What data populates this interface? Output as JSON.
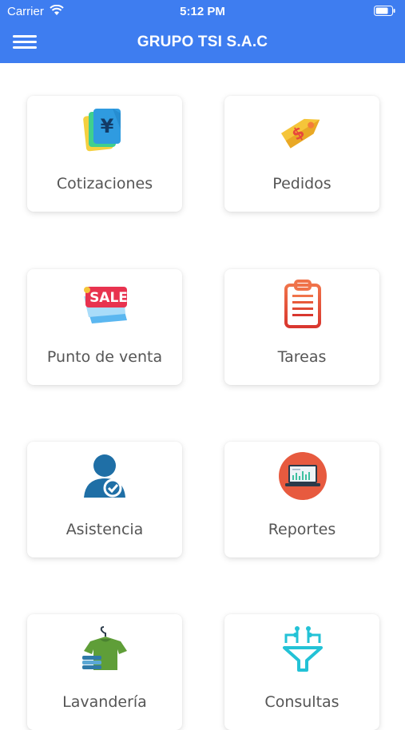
{
  "status_bar": {
    "carrier": "Carrier",
    "time": "5:12 PM"
  },
  "header": {
    "title": "GRUPO TSI S.A.C"
  },
  "modules": [
    {
      "label": "Cotizaciones",
      "icon": "banknote-icon"
    },
    {
      "label": "Pedidos",
      "icon": "price-tag-icon"
    },
    {
      "label": "Punto de venta",
      "icon": "sale-tag-icon"
    },
    {
      "label": "Tareas",
      "icon": "clipboard-icon"
    },
    {
      "label": "Asistencia",
      "icon": "user-check-icon"
    },
    {
      "label": "Reportes",
      "icon": "laptop-chart-icon"
    },
    {
      "label": "Lavandería",
      "icon": "laundry-shirt-icon"
    },
    {
      "label": "Consultas",
      "icon": "funnel-icon"
    }
  ],
  "icon_text": {
    "sale": "SALE",
    "yen": "¥",
    "dollar": "$"
  },
  "colors": {
    "primary": "#3e7df0",
    "label": "#555555"
  }
}
